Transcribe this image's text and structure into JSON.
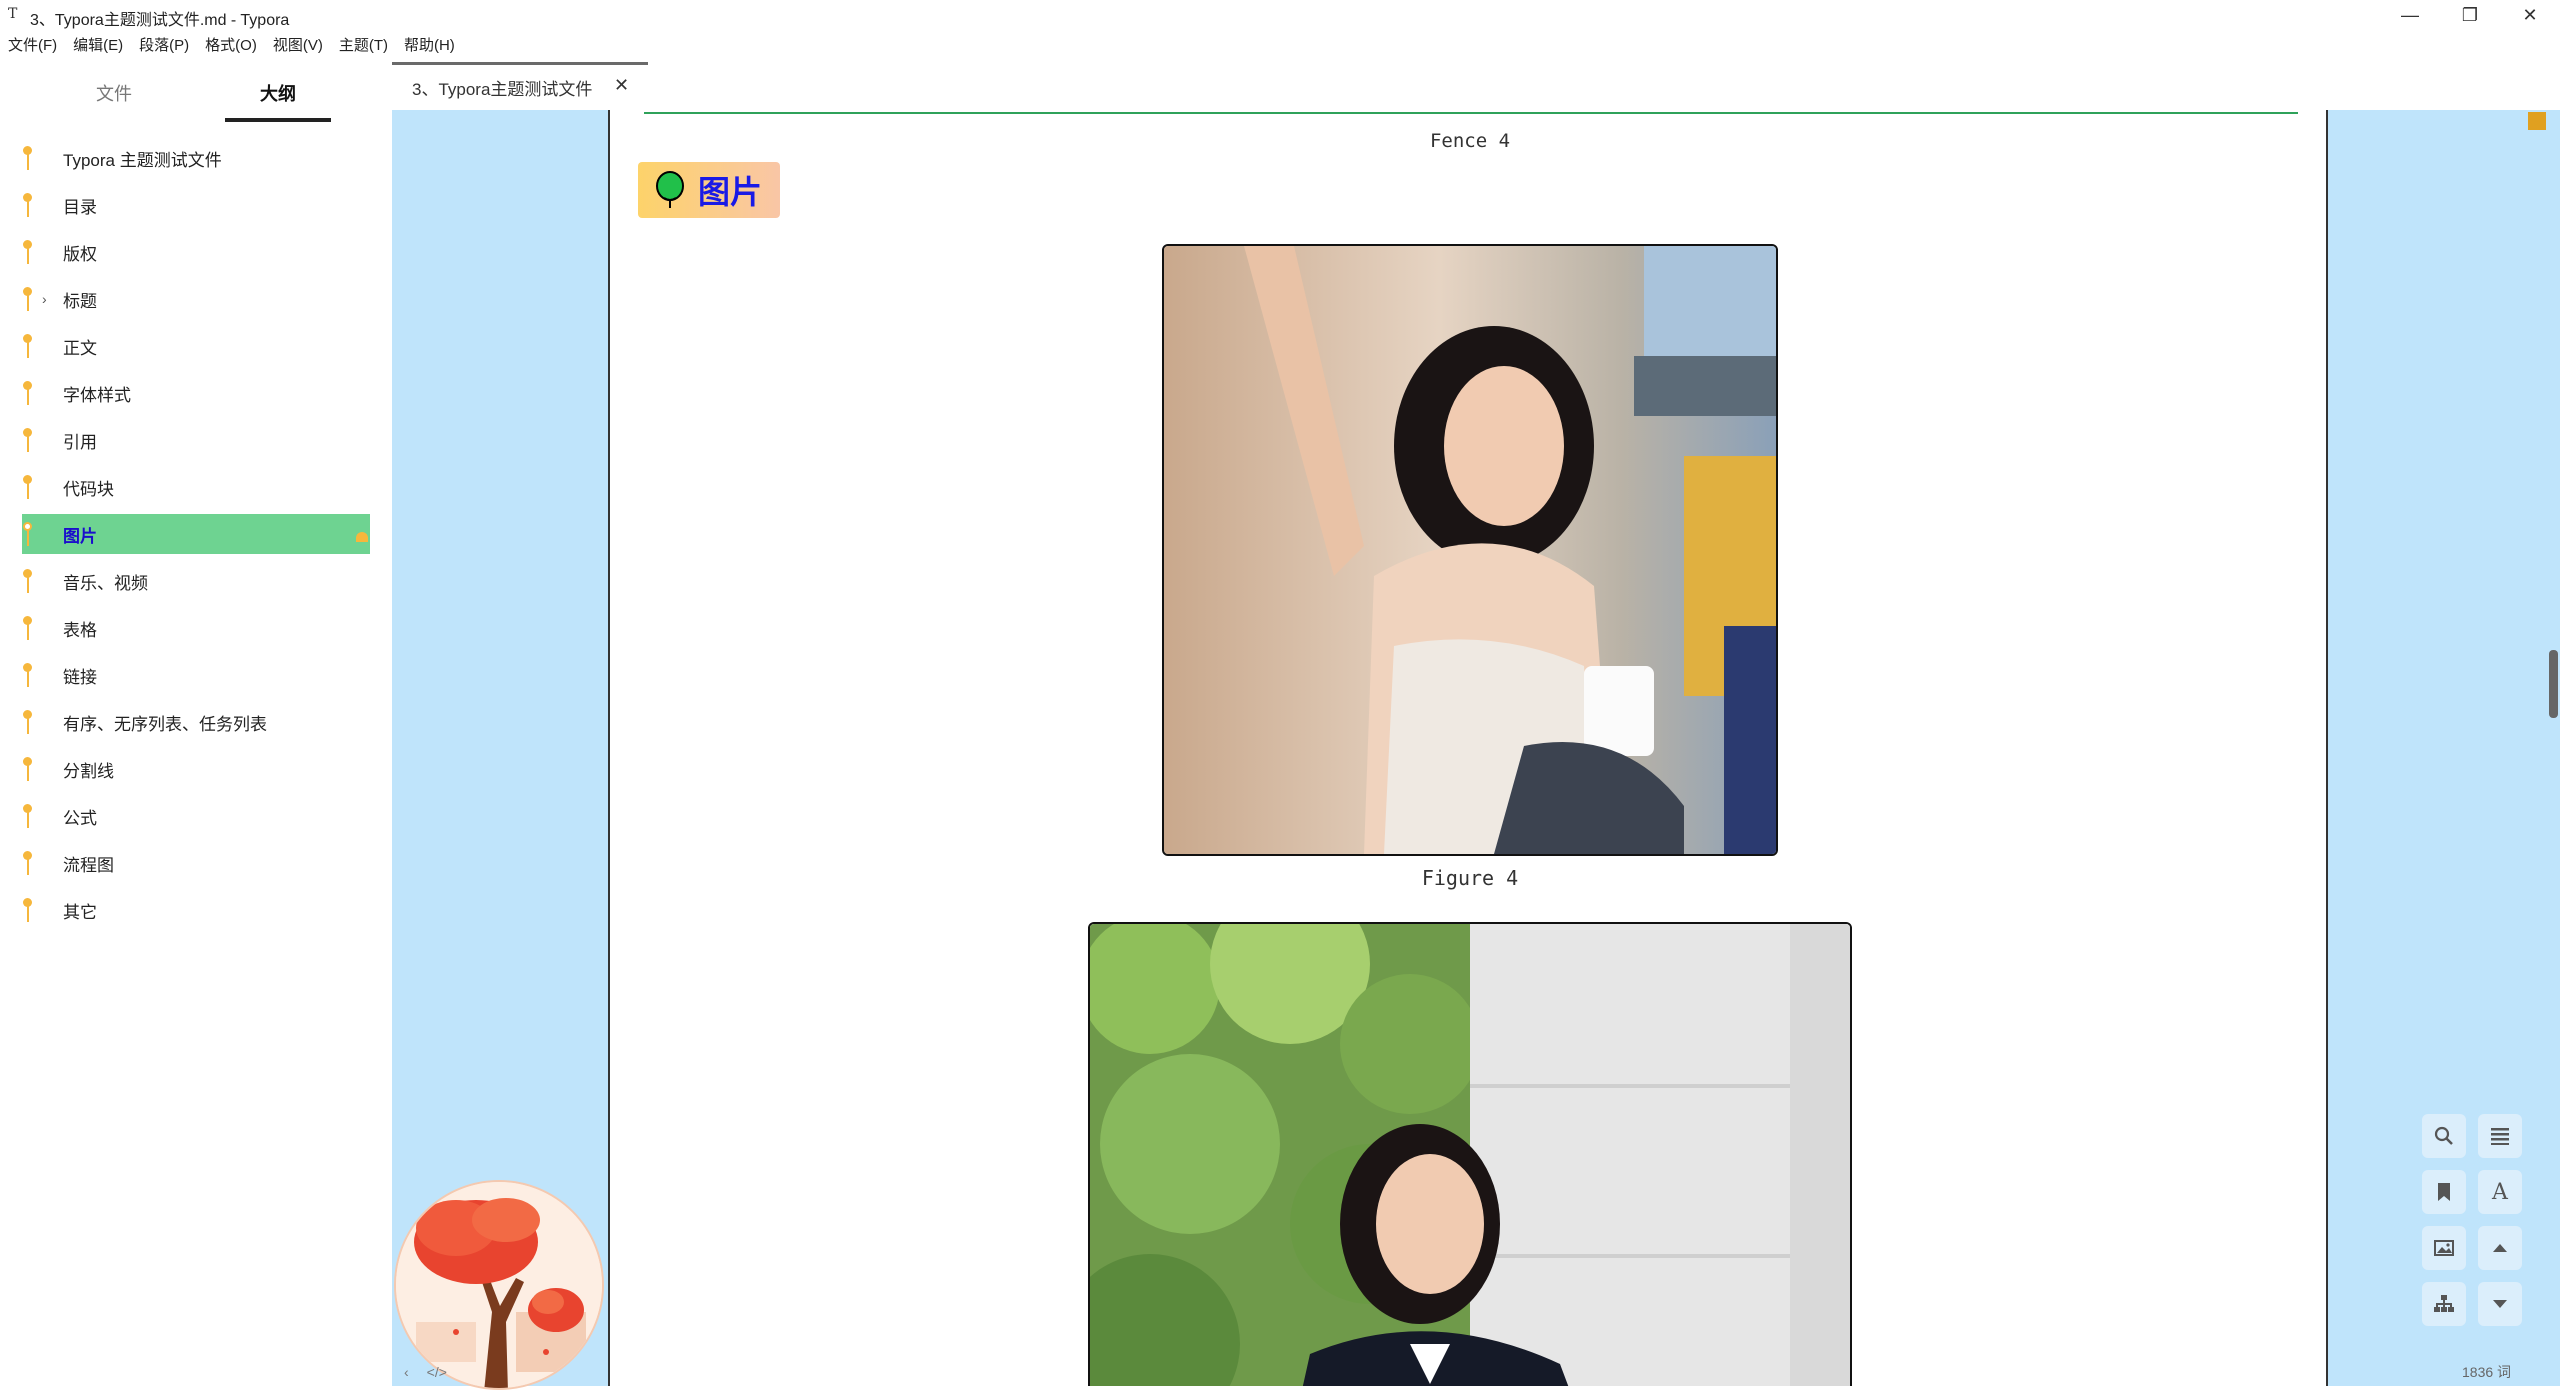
{
  "window": {
    "app_icon": "T",
    "title": "3、Typora主题测试文件.md - Typora",
    "controls": {
      "minimize": "—",
      "maximize": "❐",
      "close": "✕"
    }
  },
  "menu": [
    "文件(F)",
    "编辑(E)",
    "段落(P)",
    "格式(O)",
    "视图(V)",
    "主题(T)",
    "帮助(H)"
  ],
  "sidebar": {
    "tabs": {
      "files": "文件",
      "outline": "大纲"
    },
    "outline": [
      {
        "label": "Typora 主题测试文件"
      },
      {
        "label": "目录"
      },
      {
        "label": "版权"
      },
      {
        "label": "标题",
        "collapsed": true
      },
      {
        "label": "正文"
      },
      {
        "label": "字体样式"
      },
      {
        "label": "引用"
      },
      {
        "label": "代码块"
      },
      {
        "label": "图片",
        "active": true
      },
      {
        "label": "音乐、视频"
      },
      {
        "label": "表格"
      },
      {
        "label": "链接"
      },
      {
        "label": "有序、无序列表、任务列表"
      },
      {
        "label": "分割线"
      },
      {
        "label": "公式"
      },
      {
        "label": "流程图"
      },
      {
        "label": "其它"
      }
    ],
    "bottom_icons": {
      "collapse": "‹",
      "source": "</>"
    }
  },
  "tabs": [
    {
      "title": "3、Typora主题测试文件",
      "close": "✕"
    }
  ],
  "editor": {
    "fence_caption": "Fence 4",
    "heading": "图片",
    "figure_4_caption": "Figure 4"
  },
  "toolbar": {
    "word_count": "1836 词",
    "icons": [
      "search-icon",
      "menu-icon",
      "bookmark-icon",
      "font-icon",
      "image-icon",
      "arrow-up-icon",
      "sitemap-icon",
      "arrow-down-icon"
    ]
  },
  "colors": {
    "side_blue": "#bfe4fb",
    "active_outline": "#6ed391",
    "accent_orange": "#f6b73c",
    "heading_text": "#1a1ae6",
    "fence_line": "#2fa25a"
  }
}
